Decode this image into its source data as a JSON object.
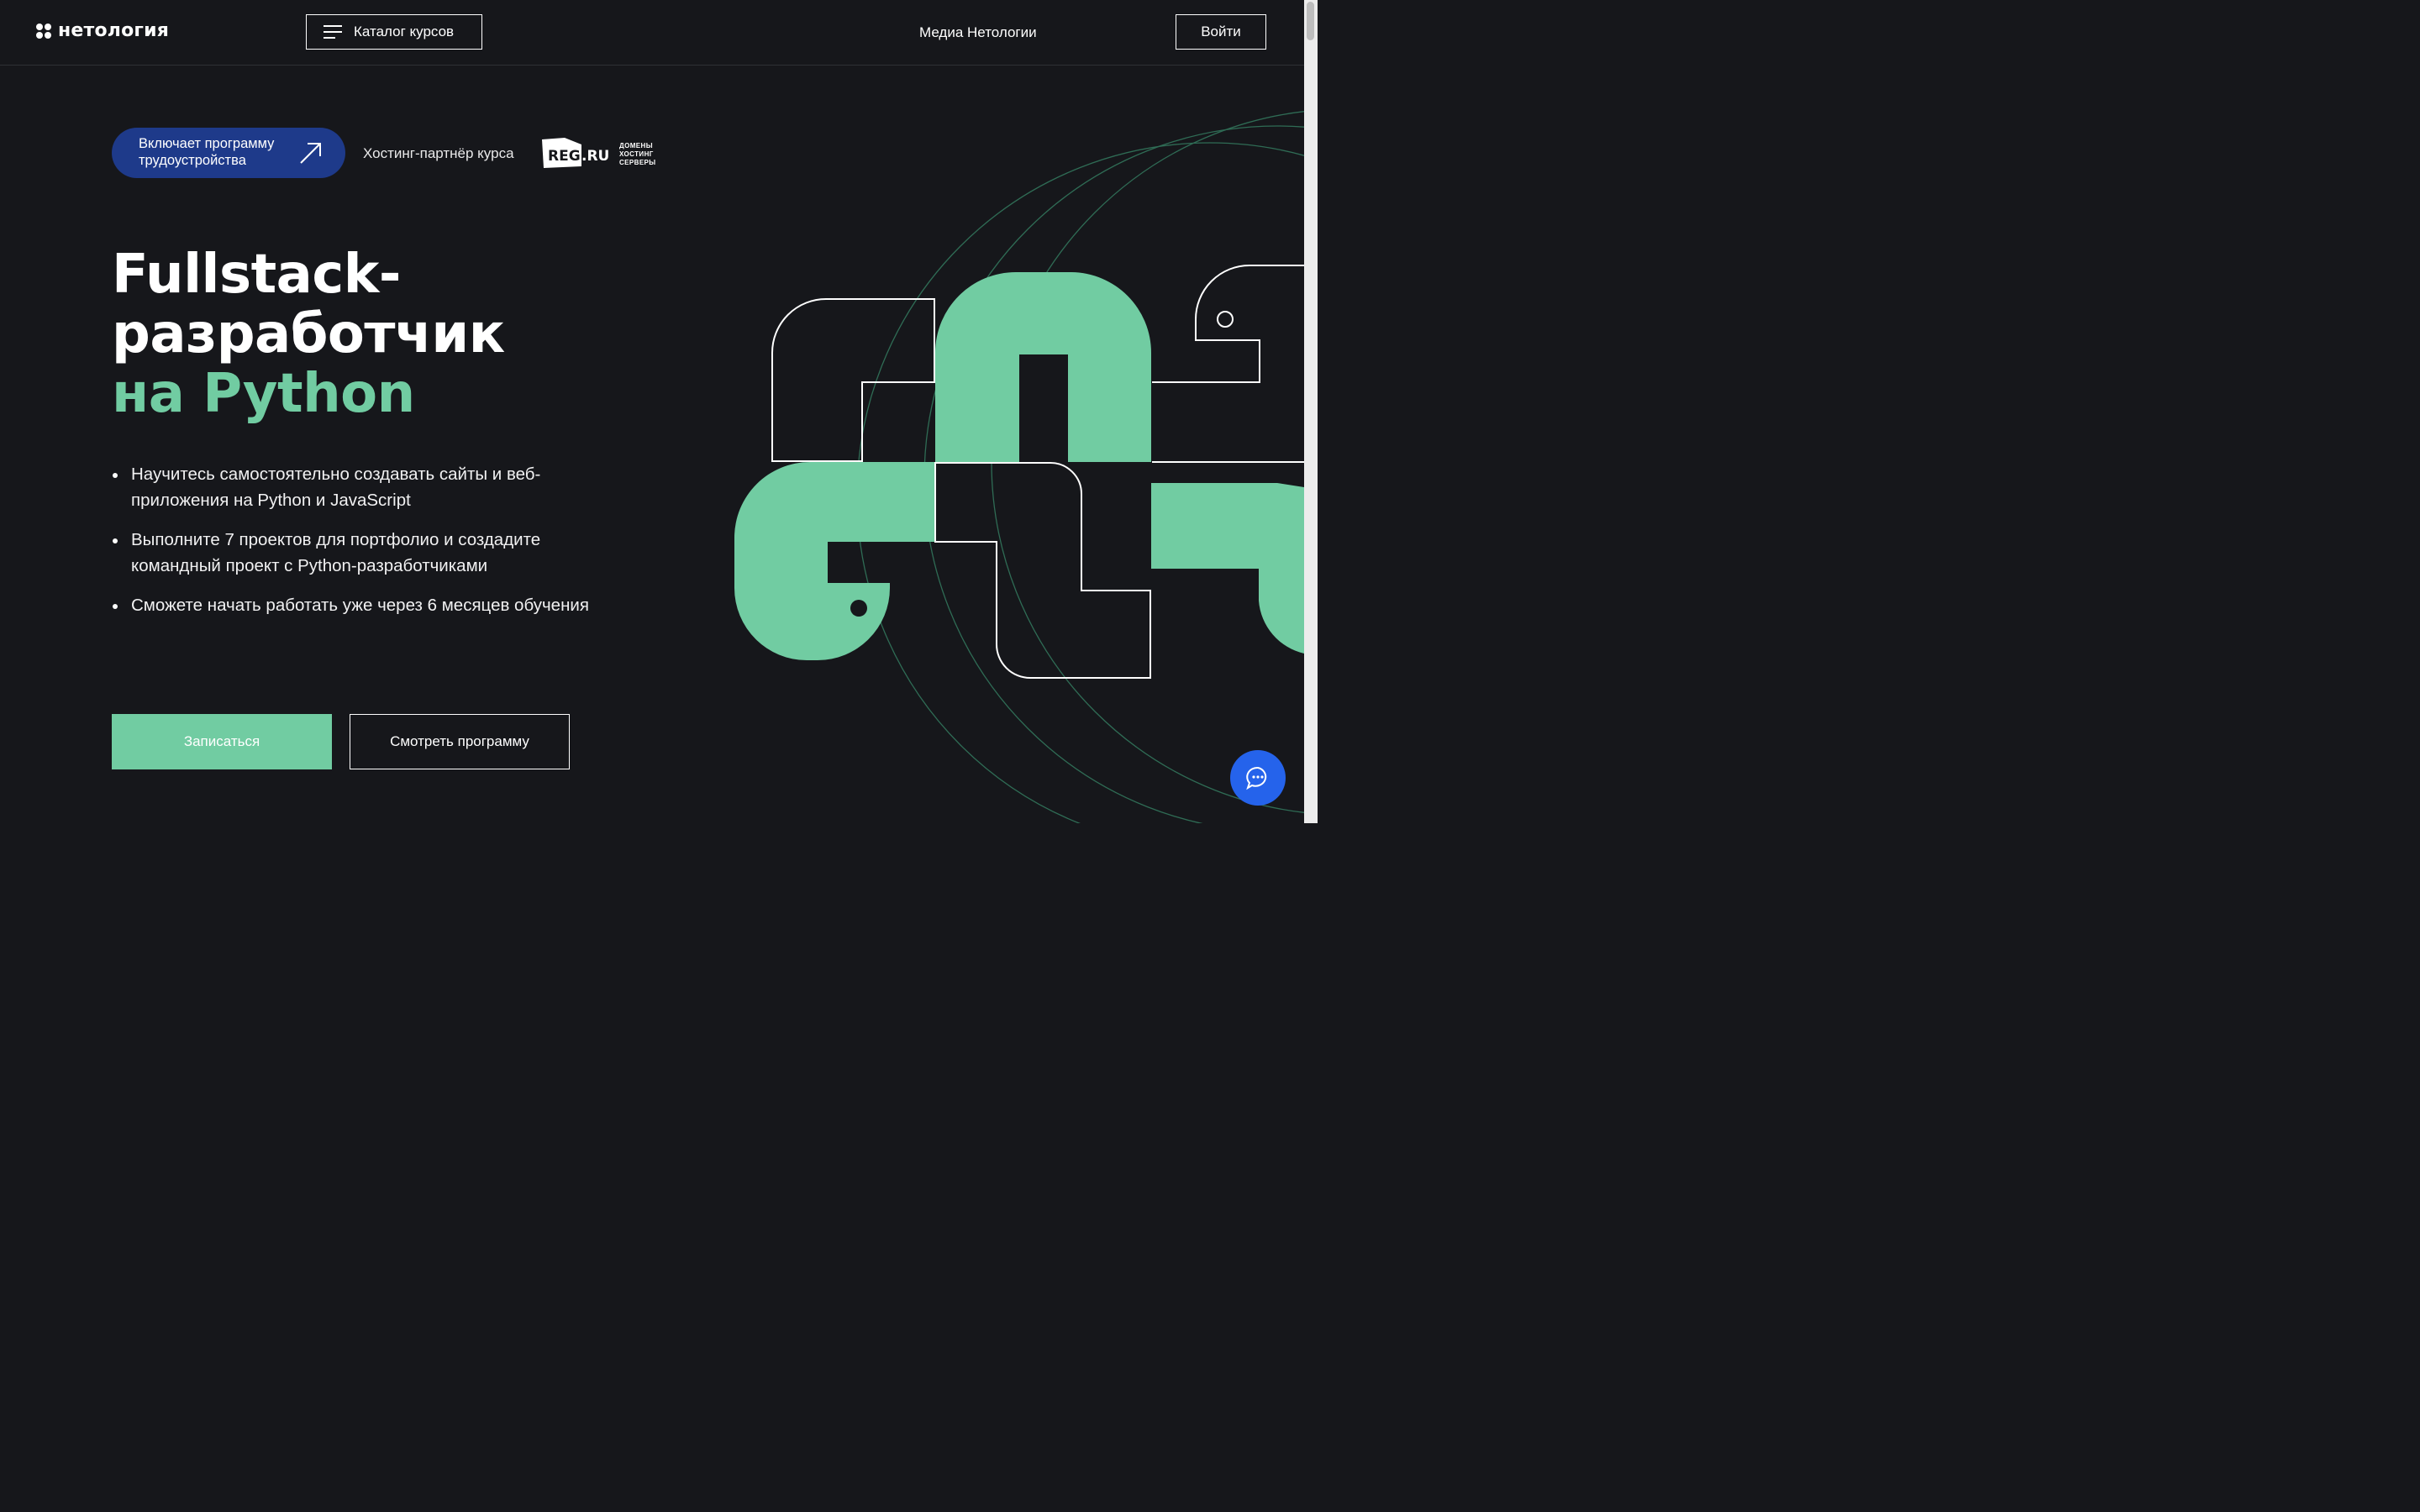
{
  "header": {
    "logo_text": "нетология",
    "catalog_label": "Каталог курсов",
    "media_label": "Медиа Нетологии",
    "login_label": "Войти"
  },
  "badges": {
    "program_line1": "Включает программу",
    "program_line2": "трудоустройства",
    "partner_text": "Хостинг-партнёр курса",
    "reg_logo_text": "REG",
    "reg_logo_suffix": ".RU",
    "reg_tag1": "ДОМЕНЫ",
    "reg_tag2": "ХОСТИНГ",
    "reg_tag3": "СЕРВЕРЫ"
  },
  "hero": {
    "title_line1": "Fullstack-",
    "title_line2": "разработчик",
    "title_line3": "на Python",
    "bullets": [
      "Научитесь самостоятельно создавать сайты и веб-приложения на Python и JavaScript",
      "Выполните 7 проектов для портфолио и создадите командный проект с Python-разработчиками",
      "Сможете начать работать уже через 6 месяцев обучения"
    ],
    "enroll_label": "Записаться",
    "program_label": "Смотреть программу"
  },
  "colors": {
    "background": "#16171b",
    "accent_green": "#71cca2",
    "pill_blue": "#1e3a8a",
    "chat_blue": "#2563eb"
  },
  "icons": {
    "menu": "burger-icon",
    "pill": "arrow-up-right-icon",
    "chat": "chat-bubble-icon"
  }
}
